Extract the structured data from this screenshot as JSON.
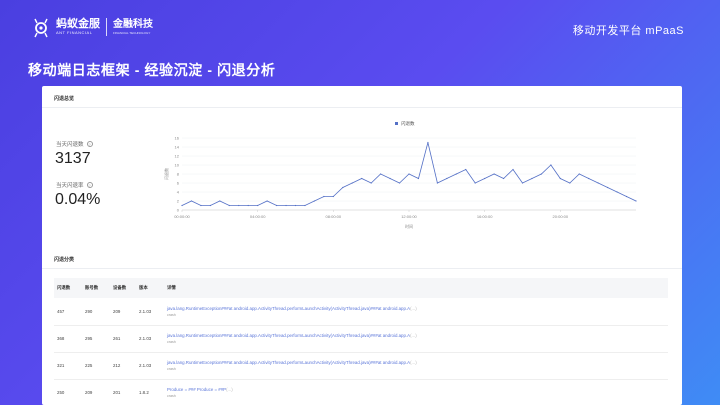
{
  "brand": {
    "logo1_cn": "蚂蚁金服",
    "logo1_en": "ANT FINANCIAL",
    "logo2_cn": "金融科技",
    "logo2_en": "FINANCIAL TECHNOLOGY",
    "platform": "移动开发平台 mPaaS"
  },
  "slide_title": "移动端日志框架 - 经验沉淀 - 闪退分析",
  "overview": {
    "title": "闪退总览",
    "today_crash_label": "当天闪退数",
    "today_crash_value": "3137",
    "today_rate_label": "当天闪退率",
    "today_rate_value": "0.04%",
    "help_icon": "?"
  },
  "chart_data": {
    "type": "line",
    "legend": [
      "闪退数"
    ],
    "legend_position": "top-center",
    "ylabel": "闪退数",
    "xlabel": "时间",
    "ylim": [
      0,
      16
    ],
    "yticks": [
      0,
      2,
      4,
      6,
      8,
      10,
      12,
      14,
      16
    ],
    "xtick_labels": [
      "00:00:00",
      "04:00:00",
      "08:00:00",
      "12:00:00",
      "16:00:00",
      "20:00:00"
    ],
    "xtick_hours": [
      0,
      4,
      8,
      12,
      16,
      20
    ],
    "series_color": "#5470c6",
    "series": [
      {
        "name": "闪退数",
        "x_hours": [
          0,
          0.5,
          1,
          1.5,
          2,
          2.5,
          3,
          3.5,
          4,
          4.5,
          5,
          5.5,
          6,
          6.5,
          7,
          7.5,
          8,
          8.5,
          9,
          9.5,
          10,
          10.5,
          11,
          11.5,
          12,
          12.5,
          13,
          13.5,
          14,
          14.5,
          15,
          15.5,
          16,
          16.5,
          17,
          17.5,
          18,
          18.5,
          19,
          19.5,
          20,
          20.5,
          21,
          21.5,
          22,
          22.5,
          23,
          23.5,
          24
        ],
        "values": [
          1,
          2,
          1,
          1,
          2,
          1,
          1,
          1,
          1,
          2,
          1,
          1,
          1,
          1,
          2,
          3,
          3,
          5,
          6,
          7,
          6,
          8,
          7,
          6,
          8,
          7,
          15,
          6,
          7,
          8,
          9,
          6,
          7,
          8,
          7,
          9,
          6,
          7,
          8,
          10,
          7,
          6,
          8,
          7,
          6,
          5,
          4,
          3,
          2
        ]
      }
    ]
  },
  "classification": {
    "title": "闪退分类",
    "columns": [
      "闪退数",
      "账号数",
      "设备数",
      "版本",
      "详情"
    ],
    "rows": [
      [
        "457",
        "290",
        "209",
        "2.1.03",
        "java.lang.RuntimeException###at android.app.ActivityThread.performLaunchActivity(ActivityThread.java)###at android.app.A",
        "(...)",
        "crash"
      ],
      [
        "368",
        "295",
        "261",
        "2.1.03",
        "java.lang.RuntimeException###at android.app.ActivityThread.performLaunchActivity(ActivityThread.java)###at android.app.A",
        "(...)",
        "crash"
      ],
      [
        "321",
        "225",
        "212",
        "2.1.03",
        "java.lang.RuntimeException###at android.app.ActivityThread.performLaunchActivity(ActivityThread.java)###at android.app.A",
        "(...)",
        "crash"
      ],
      [
        "250",
        "209",
        "201",
        "1.8.2",
        "Produce = ### Produce = ##P",
        "(...)",
        "crash"
      ]
    ]
  }
}
